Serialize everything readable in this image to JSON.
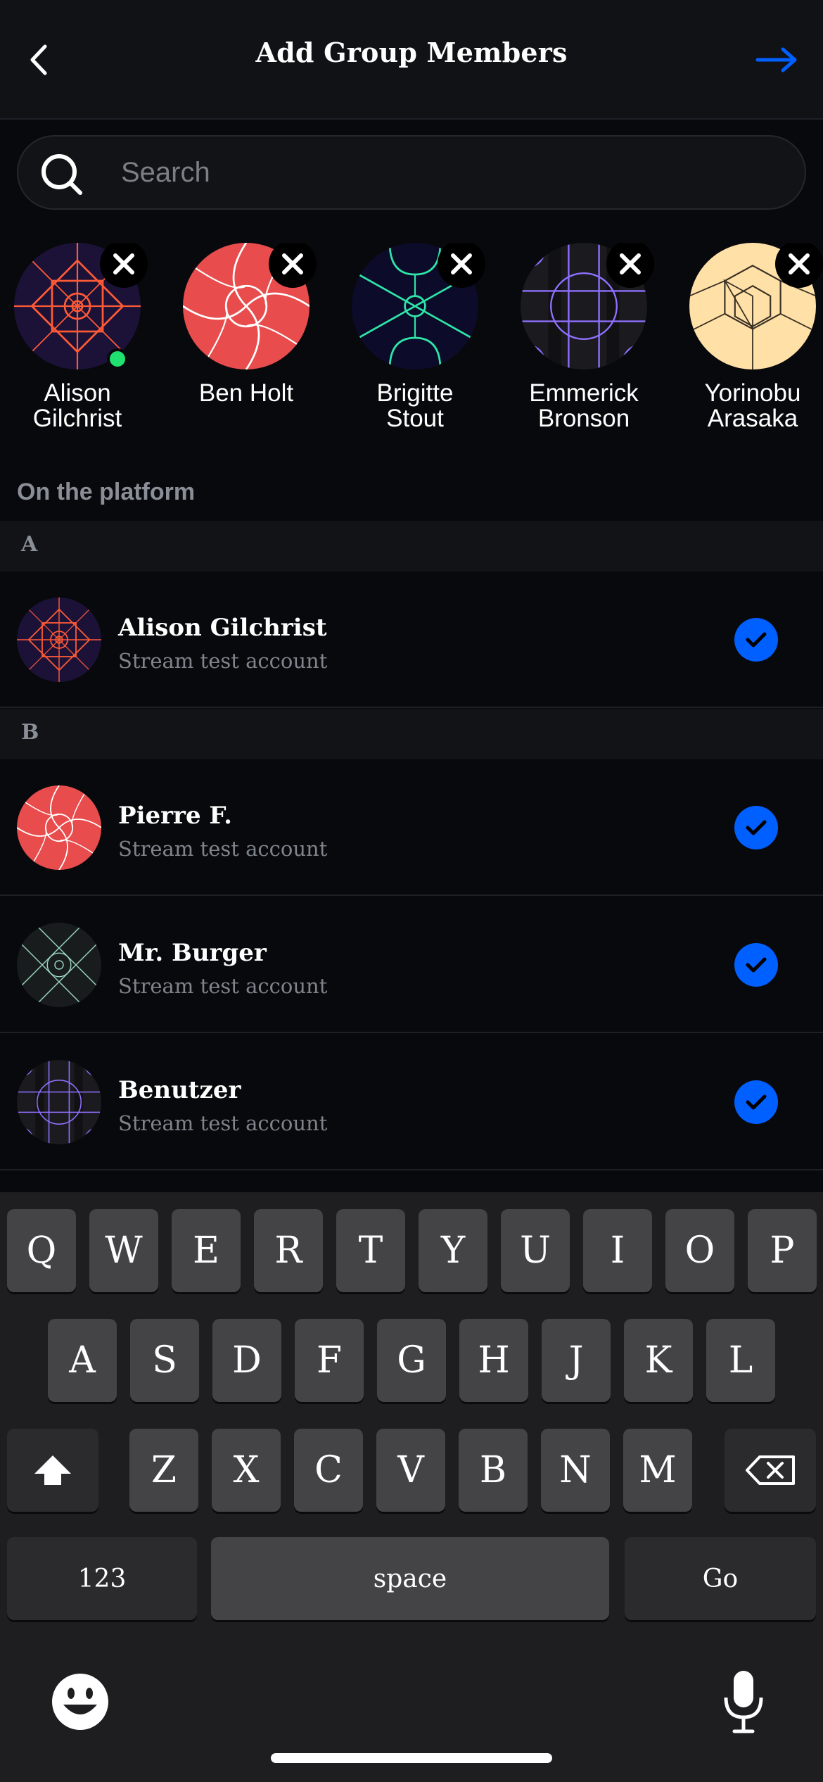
{
  "header": {
    "title": "Add Group Members"
  },
  "search": {
    "placeholder": "Search",
    "value": ""
  },
  "selected": [
    {
      "name": "Alison Gilchrist",
      "online": true,
      "avatar": "alison"
    },
    {
      "name": "Ben Holt",
      "online": false,
      "avatar": "red"
    },
    {
      "name": "Brigitte Stout",
      "online": false,
      "avatar": "green"
    },
    {
      "name": "Emmerick Bronson",
      "online": false,
      "avatar": "purple"
    },
    {
      "name": "Yorinobu Arasaka",
      "online": false,
      "avatar": "peach"
    }
  ],
  "section_label": "On the platform",
  "groups": [
    {
      "letter": "A",
      "users": [
        {
          "name": "Alison Gilchrist",
          "subtitle": "Stream test account",
          "avatar": "alison",
          "selected": true
        }
      ]
    },
    {
      "letter": "B",
      "users": [
        {
          "name": "Pierre F.",
          "subtitle": "Stream test account",
          "avatar": "red",
          "selected": true
        },
        {
          "name": "Mr. Burger",
          "subtitle": "Stream test account",
          "avatar": "mint",
          "selected": true
        },
        {
          "name": "Benutzer",
          "subtitle": "Stream test account",
          "avatar": "purple",
          "selected": true
        }
      ]
    }
  ],
  "keyboard": {
    "row1": [
      "Q",
      "W",
      "E",
      "R",
      "T",
      "Y",
      "U",
      "I",
      "O",
      "P"
    ],
    "row2": [
      "A",
      "S",
      "D",
      "F",
      "G",
      "H",
      "J",
      "K",
      "L"
    ],
    "row3": [
      "Z",
      "X",
      "C",
      "V",
      "B",
      "N",
      "M"
    ],
    "numbers_label": "123",
    "space_label": "space",
    "go_label": "Go"
  },
  "colors": {
    "accent": "#005fff",
    "online": "#20e070",
    "background": "#08090c"
  }
}
